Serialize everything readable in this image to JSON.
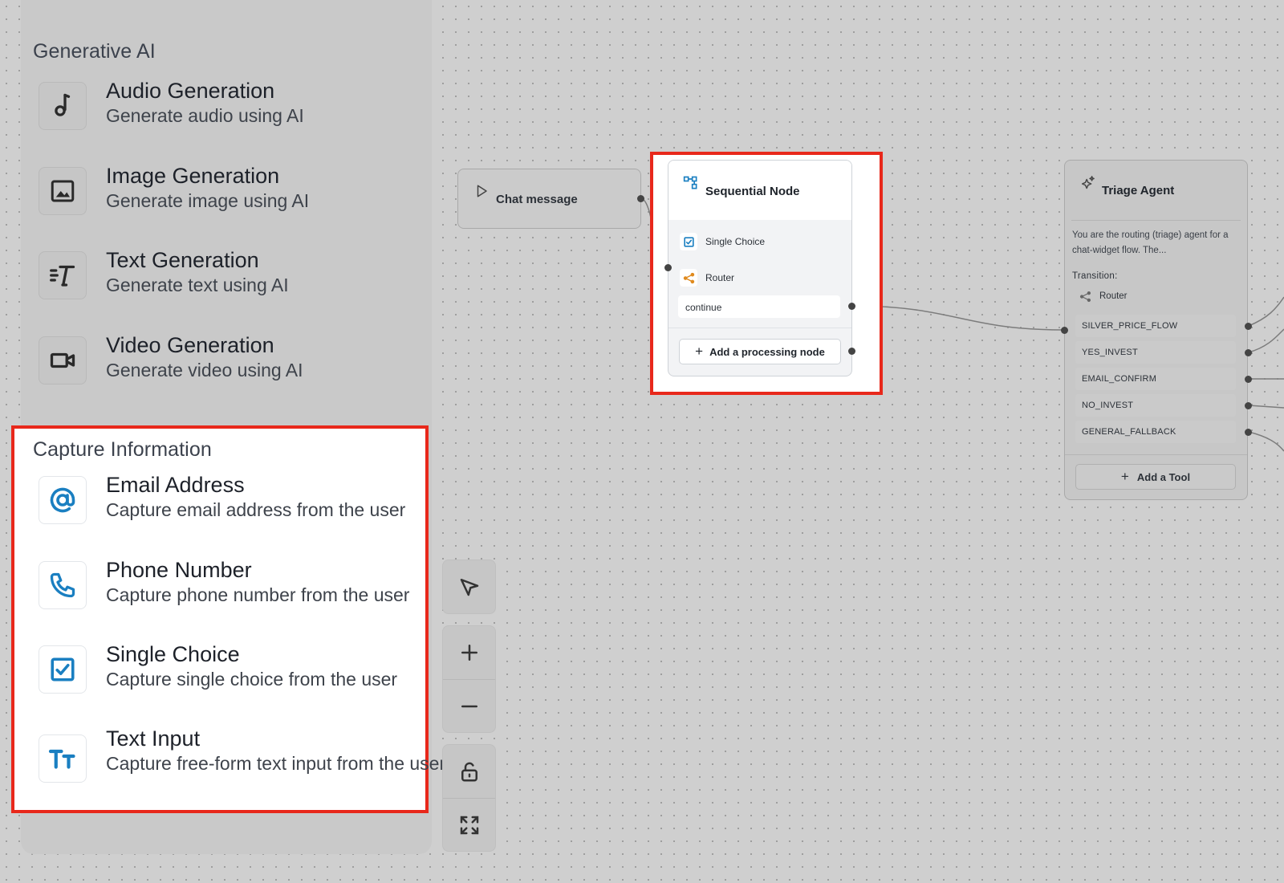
{
  "palette": {
    "generative": {
      "title": "Generative AI",
      "items": [
        {
          "title": "Audio Generation",
          "desc": "Generate audio using AI",
          "icon": "music-note-icon"
        },
        {
          "title": "Image Generation",
          "desc": "Generate image using AI",
          "icon": "image-icon"
        },
        {
          "title": "Text Generation",
          "desc": "Generate text using AI",
          "icon": "text-ai-icon"
        },
        {
          "title": "Video Generation",
          "desc": "Generate video using AI",
          "icon": "video-camera-icon"
        }
      ]
    },
    "capture": {
      "title": "Capture Information",
      "items": [
        {
          "title": "Email Address",
          "desc": "Capture email address from the user",
          "icon": "at-sign-icon"
        },
        {
          "title": "Phone Number",
          "desc": "Capture phone number from the user",
          "icon": "phone-icon"
        },
        {
          "title": "Single Choice",
          "desc": "Capture single choice from the user",
          "icon": "checkbox-icon"
        },
        {
          "title": "Text Input",
          "desc": "Capture free-form text input from the user",
          "icon": "text-size-icon"
        }
      ]
    }
  },
  "controls": [
    "pointer-icon",
    "zoom-in-icon",
    "zoom-out-icon",
    "lock-icon",
    "fit-view-icon"
  ],
  "chat_node": {
    "label": "Chat message"
  },
  "sequential_node": {
    "title": "Sequential Node",
    "rows": [
      {
        "label": "Single Choice",
        "icon": "checkbox-icon"
      },
      {
        "label": "Router",
        "icon": "router-icon"
      }
    ],
    "output": "continue",
    "add_label": "Add a processing node"
  },
  "triage_node": {
    "title": "Triage Agent",
    "description": "You are the routing (triage) agent for a chat-widget flow. The...",
    "transition_label": "Transition:",
    "router_label": "Router",
    "routes": [
      "SILVER_PRICE_FLOW",
      "YES_INVEST",
      "EMAIL_CONFIRM",
      "NO_INVEST",
      "GENERAL_FALLBACK"
    ],
    "add_tool_label": "Add a Tool"
  },
  "colors": {
    "highlight": "#e8281b",
    "accent_blue": "#1a7fc1",
    "router_orange": "#e08a1e"
  }
}
